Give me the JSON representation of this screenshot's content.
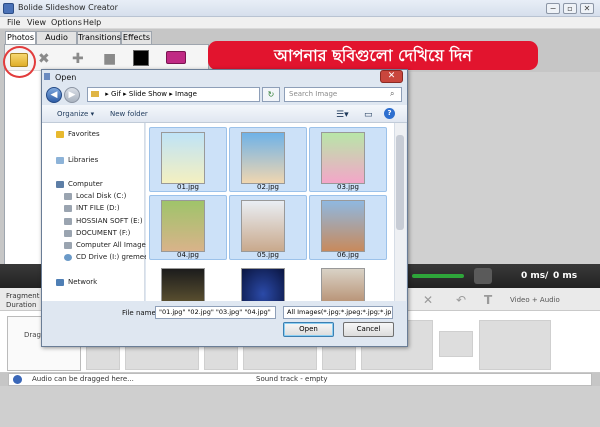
{
  "app": {
    "title": "Bolide Slideshow Creator",
    "window_buttons": [
      "−",
      "▫",
      "✕"
    ],
    "menu": [
      "File",
      "View",
      "Options",
      "Help"
    ],
    "tabs": [
      "Photos",
      "Audio files",
      "Transitions",
      "Effects"
    ],
    "banner_text": "আপনার ছবিগুলো দেখিয়ে দিন",
    "time_current": "0 ms",
    "time_separator": "/",
    "time_total": "0 ms",
    "fragment_label": "Fragment",
    "duration_label": "Duration",
    "video_audio_label": "Video + Audio",
    "drag_hint_1": "Drag y",
    "drag_hint_2": "H",
    "audio_hint": "Audio can be dragged here...",
    "sound_track": "Sound track - empty"
  },
  "dialog": {
    "title": "Open",
    "close_glyph": "✕",
    "back_glyph": "◀",
    "forward_glyph": "▶",
    "breadcrumb": [
      "Gif",
      "Slide Show",
      "Image"
    ],
    "search_placeholder": "Search Image",
    "organize": "Organize ▾",
    "new_folder": "New folder",
    "nav": {
      "favorites": "Favorites",
      "libraries": "Libraries",
      "computer": "Computer",
      "drives": [
        "Local Disk (C:)",
        "INT FILE (D:)",
        "HOSSIAN SOFT (E:)",
        "DOCUMENT (F:)",
        "Computer All Image",
        "CD Drive (I:) gremee"
      ],
      "network": "Network"
    },
    "files": [
      "01.jpg",
      "02.jpg",
      "03.jpg",
      "04.jpg",
      "05.jpg",
      "06.jpg",
      "",
      "",
      ""
    ],
    "file_name_label": "File name:",
    "file_name_value": "\"01.jpg\" \"02.jpg\" \"03.jpg\" \"04.jpg\"",
    "file_type": "All Images(*.jpg;*.jpeg;*.jpg;*.jp",
    "open_button": "Open",
    "cancel_button": "Cancel"
  },
  "colors": {
    "banner": "#e2142e",
    "selection_tile": "#cce1f8",
    "annotation_circle": "#e23c3c"
  }
}
